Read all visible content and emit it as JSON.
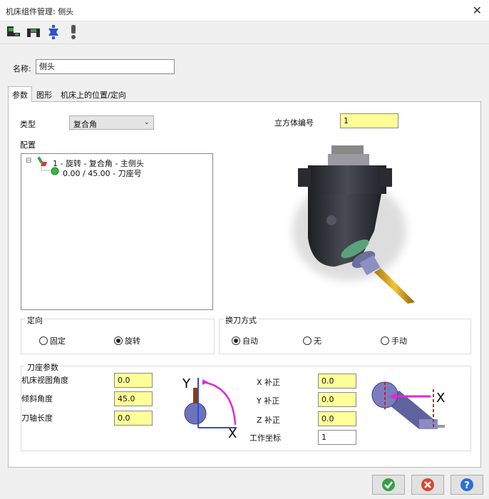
{
  "window": {
    "title": "机床组件管理: 侧头",
    "close_glyph": "✕"
  },
  "toolbar": {
    "icons": [
      "machine-head-icon",
      "tool-holder-icon",
      "spindle-icon",
      "warning-icon"
    ]
  },
  "name_field": {
    "label": "名称:",
    "value": "侧头"
  },
  "tabs": [
    {
      "label": "参数",
      "active": true
    },
    {
      "label": "图形",
      "active": false
    },
    {
      "label": "机床上的位置/定向",
      "active": false
    }
  ],
  "params": {
    "type_label": "类型",
    "type_value": "复合角",
    "cube_label": "立方体编号",
    "cube_value": "1",
    "config_label": "配置",
    "tree": {
      "collapse_glyph": "⊟",
      "row1": "1 - 旋转 - 复合角 - 主侧头",
      "row2": "0.00 / 45.00 - 刀座号"
    }
  },
  "orientation": {
    "title": "定向",
    "options": [
      {
        "label": "固定",
        "selected": false
      },
      {
        "label": "旋转",
        "selected": true
      }
    ]
  },
  "tool_change": {
    "title": "换刀方式",
    "options": [
      {
        "label": "自动",
        "selected": true
      },
      {
        "label": "无",
        "selected": false
      },
      {
        "label": "手动",
        "selected": false
      }
    ]
  },
  "holder_params": {
    "title": "刀座参数",
    "view_angle_label": "机床视图角度",
    "view_angle_value": "0.0",
    "tilt_angle_label": "倾斜角度",
    "tilt_angle_value": "45.0",
    "axis_length_label": "刀轴长度",
    "axis_length_value": "0.0",
    "x_offset_label": "X 补正",
    "x_offset_value": "0.0",
    "y_offset_label": "Y 补正",
    "y_offset_value": "0.0",
    "z_offset_label": "Z 补正",
    "z_offset_value": "0.0",
    "work_coord_label": "工作坐标",
    "work_coord_value": "1",
    "diagram1": {
      "y_label": "Y",
      "x_label": "X"
    },
    "diagram2": {
      "x_label": "X"
    }
  },
  "buttons": {
    "ok": "check-icon",
    "cancel": "cancel-icon",
    "help_glyph": "?"
  },
  "colors": {
    "yellow_field": "#ffff99",
    "ok_green": "#4caf50",
    "cancel_red": "#d9462f",
    "help_blue": "#2f6fd3"
  }
}
